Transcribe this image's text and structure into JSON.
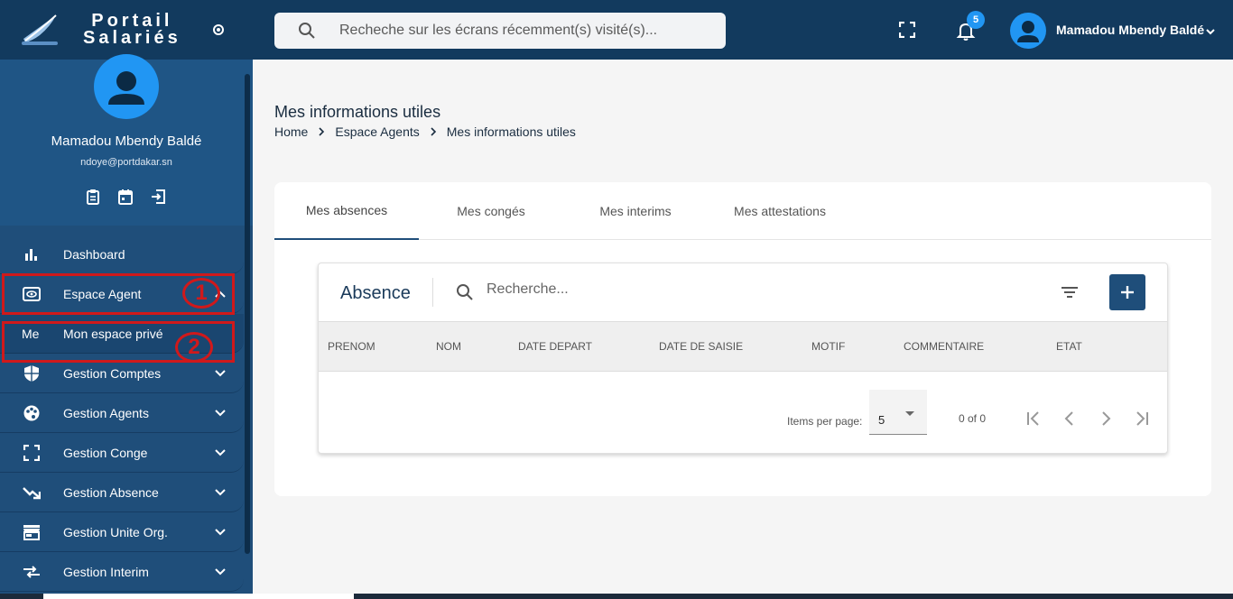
{
  "brand": {
    "line1": "Portail",
    "line2": "Salariés"
  },
  "profile": {
    "name": "Mamadou Mbendy Baldé",
    "email": "ndoye@portdakar.sn"
  },
  "nav": {
    "items": [
      {
        "label": "Dashboard",
        "icon": "bar-chart-icon"
      },
      {
        "label": "Espace Agent",
        "icon": "eye-card-icon"
      },
      {
        "abbr": "Me",
        "label": "Mon espace privé"
      },
      {
        "label": "Gestion Comptes",
        "icon": "shield-icon"
      },
      {
        "label": "Gestion Agents",
        "icon": "palette-icon"
      },
      {
        "label": "Gestion Conge",
        "icon": "fullscreen-icon"
      },
      {
        "label": "Gestion Absence",
        "icon": "trending-down-icon"
      },
      {
        "label": "Gestion Unite Org.",
        "icon": "store-icon"
      },
      {
        "label": "Gestion Interim",
        "icon": "swap-icon"
      }
    ]
  },
  "annotations": {
    "one": "1",
    "two": "2",
    "color": "#d0191b"
  },
  "topbar": {
    "search_placeholder": "Recheche sur les écrans récemment(s) visité(s)...",
    "notifications_count": "5",
    "user_name": "Mamadou Mbendy Baldé"
  },
  "page": {
    "title": "Mes informations utiles",
    "breadcrumb": [
      "Home",
      "Espace Agents",
      "Mes informations utiles"
    ]
  },
  "tabs": [
    "Mes absences",
    "Mes congés",
    "Mes interims",
    "Mes attestations"
  ],
  "table": {
    "title": "Absence",
    "search_placeholder": "Recherche...",
    "columns": [
      "PRENOM",
      "NOM",
      "DATE DEPART",
      "DATE DE SAISIE",
      "MOTIF",
      "COMMENTAIRE",
      "ETAT"
    ],
    "paginator": {
      "items_per_page_label": "Items per page:",
      "page_size": "5",
      "range": "0 of 0"
    }
  },
  "colors": {
    "sidebar": "#1f4e7a",
    "topbar": "#123a5e",
    "accent": "#2196f3"
  }
}
